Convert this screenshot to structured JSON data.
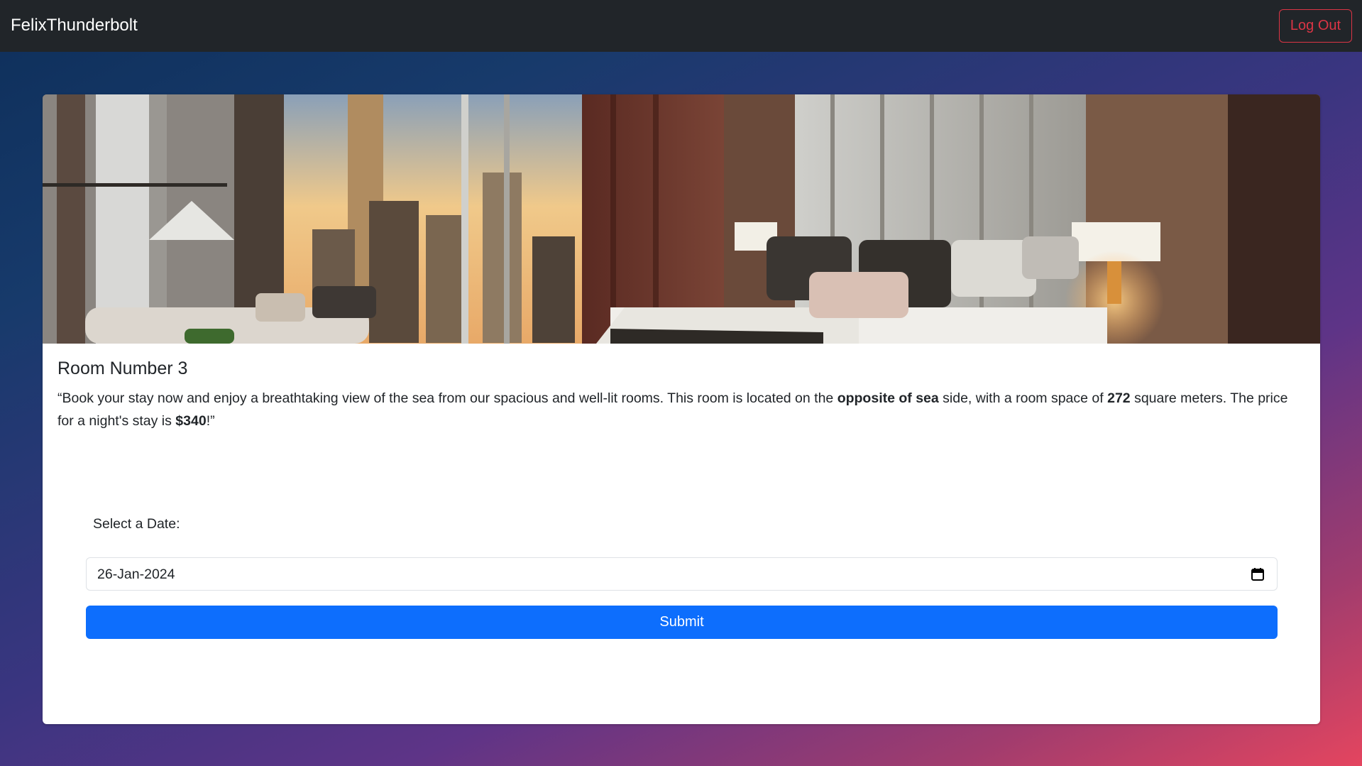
{
  "navbar": {
    "brand": "FelixThunderbolt",
    "logout_label": "Log Out"
  },
  "room": {
    "title": "Room Number 3",
    "desc_prefix": "“Book your stay now and enjoy a breathtaking view of the sea from our spacious and well-lit rooms. This room is located on the ",
    "side": "opposite of sea",
    "desc_mid1": " side, with a room space of ",
    "size": "272",
    "desc_mid2": " square meters. The price for a night's stay is ",
    "price": "$340",
    "desc_suffix": "!”"
  },
  "booking": {
    "date_label": "Select a Date:",
    "date_value": "26-Jan-2024",
    "submit_label": "Submit"
  },
  "colors": {
    "navbar_bg": "#212529",
    "logout": "#dc3545",
    "submit_bg": "#0d6efd"
  }
}
